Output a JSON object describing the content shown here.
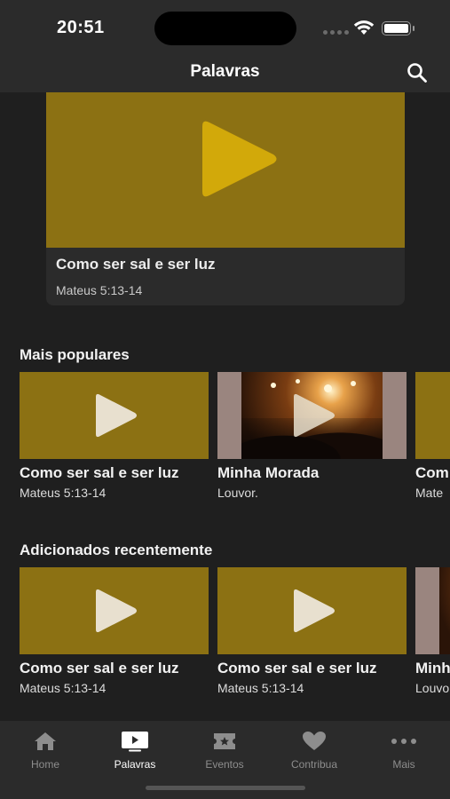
{
  "status": {
    "time": "20:51"
  },
  "nav": {
    "title": "Palavras"
  },
  "featured": {
    "title": "Como ser sal e ser luz",
    "subtitle": "Mateus 5:13-14"
  },
  "sections": [
    {
      "title": "Mais populares",
      "items": [
        {
          "title": "Como ser sal e ser luz",
          "subtitle": "Mateus 5:13-14",
          "thumb": "gold-play"
        },
        {
          "title": "Minha Morada",
          "subtitle": "Louvor.",
          "thumb": "concert-photo"
        },
        {
          "title": "Com",
          "subtitle": "Mate",
          "thumb": "gold"
        }
      ]
    },
    {
      "title": "Adicionados recentemente",
      "items": [
        {
          "title": "Como ser sal e ser luz",
          "subtitle": "Mateus 5:13-14",
          "thumb": "gold-play"
        },
        {
          "title": "Como ser sal e ser luz",
          "subtitle": "Mateus 5:13-14",
          "thumb": "gold-play"
        },
        {
          "title": "Minh",
          "subtitle": "Louvo",
          "thumb": "concert-photo"
        }
      ]
    }
  ],
  "tabs": [
    {
      "label": "Home",
      "icon": "home-icon"
    },
    {
      "label": "Palavras",
      "icon": "video-icon",
      "active": true
    },
    {
      "label": "Eventos",
      "icon": "ticket-icon"
    },
    {
      "label": "Contribua",
      "icon": "heart-icon"
    },
    {
      "label": "Mais",
      "icon": "more-icon"
    }
  ],
  "colors": {
    "background": "#1f1f1f",
    "bar": "#2b2b2b",
    "gold_thumb": "#8c7113",
    "featured_play": "#d2a90a",
    "tab_inactive": "#8d8d8d"
  }
}
